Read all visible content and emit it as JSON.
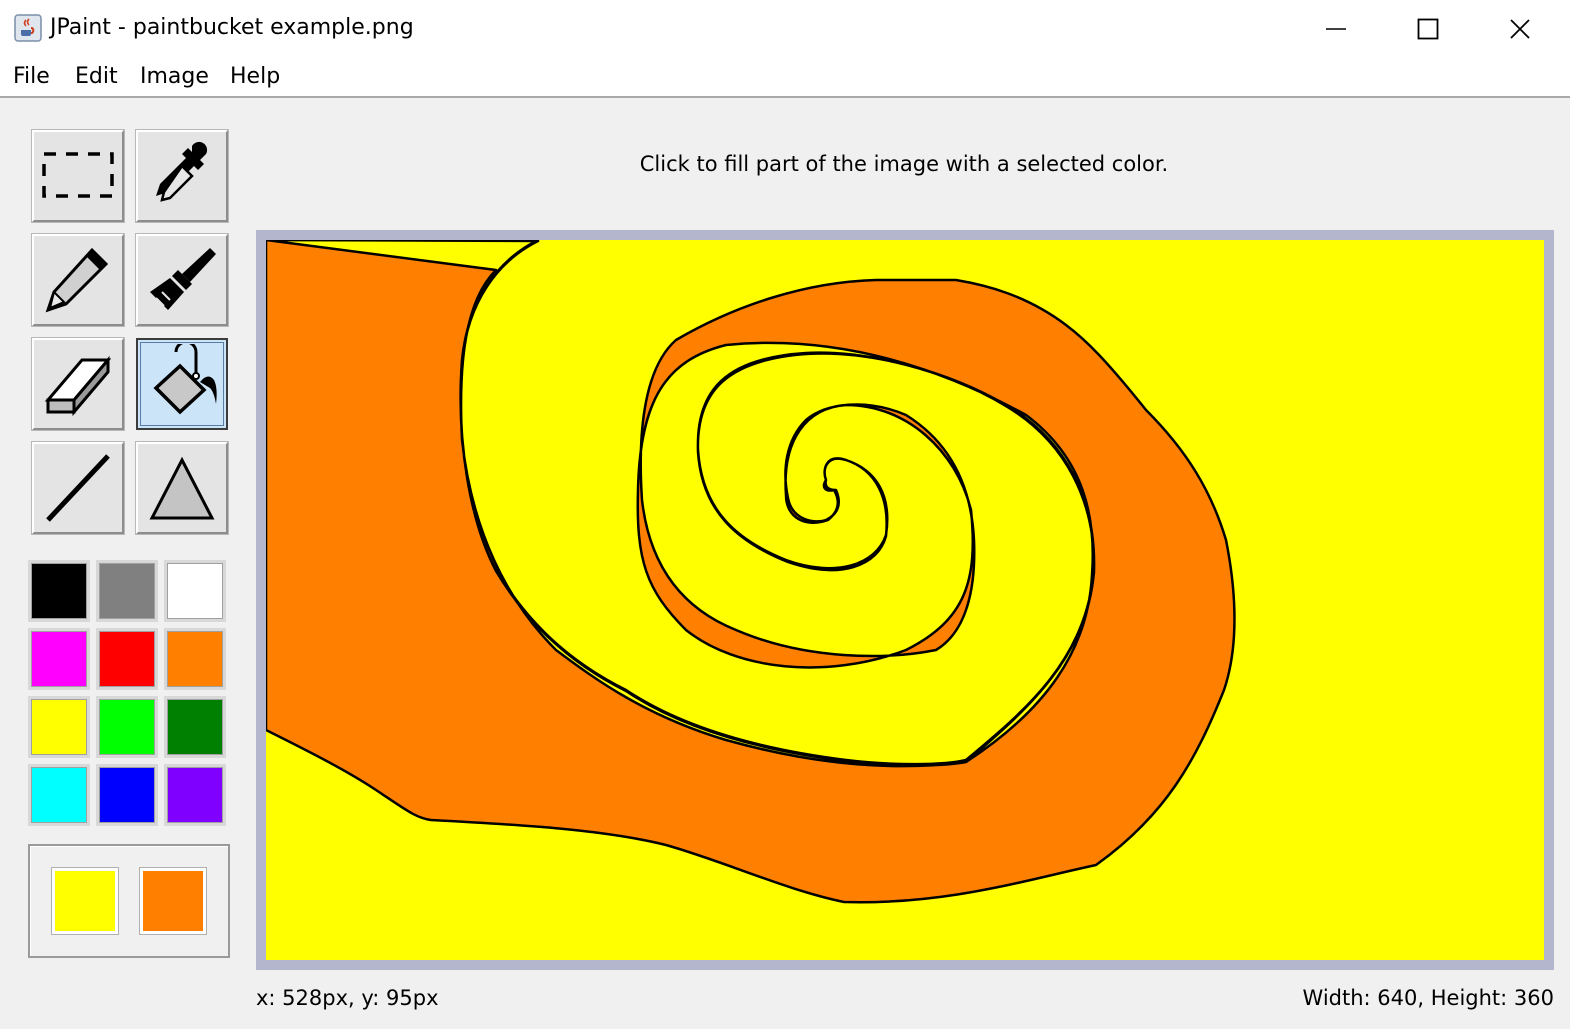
{
  "window": {
    "title": "JPaint - paintbucket example.png",
    "controls": [
      "minimize",
      "maximize",
      "close"
    ]
  },
  "menu": {
    "items": [
      "File",
      "Edit",
      "Image",
      "Help"
    ]
  },
  "tools": [
    {
      "name": "select",
      "icon": "dashed-rectangle-icon",
      "selected": false
    },
    {
      "name": "color-picker",
      "icon": "eyedropper-icon",
      "selected": false
    },
    {
      "name": "pencil",
      "icon": "pencil-icon",
      "selected": false
    },
    {
      "name": "brush",
      "icon": "paintbrush-icon",
      "selected": false
    },
    {
      "name": "eraser",
      "icon": "eraser-icon",
      "selected": false
    },
    {
      "name": "paint-bucket",
      "icon": "paint-bucket-icon",
      "selected": true
    },
    {
      "name": "line",
      "icon": "line-icon",
      "selected": false
    },
    {
      "name": "shape",
      "icon": "triangle-icon",
      "selected": false
    }
  ],
  "palette": [
    "#000000",
    "#808080",
    "#ffffff",
    "#ff00ff",
    "#ff0000",
    "#ff8000",
    "#ffff00",
    "#00ff00",
    "#008000",
    "#00ffff",
    "#0000ff",
    "#8000ff"
  ],
  "current_colors": {
    "primary": "#ffff00",
    "secondary": "#ff8000"
  },
  "hint_text": "Click to fill part of the image with a selected color.",
  "canvas_colors": {
    "background": "#ffff00",
    "fill": "#ff8000",
    "outline": "#000000"
  },
  "status": {
    "cursor": "x: 528px, y: 95px",
    "dimensions": "Width: 640, Height: 360"
  }
}
